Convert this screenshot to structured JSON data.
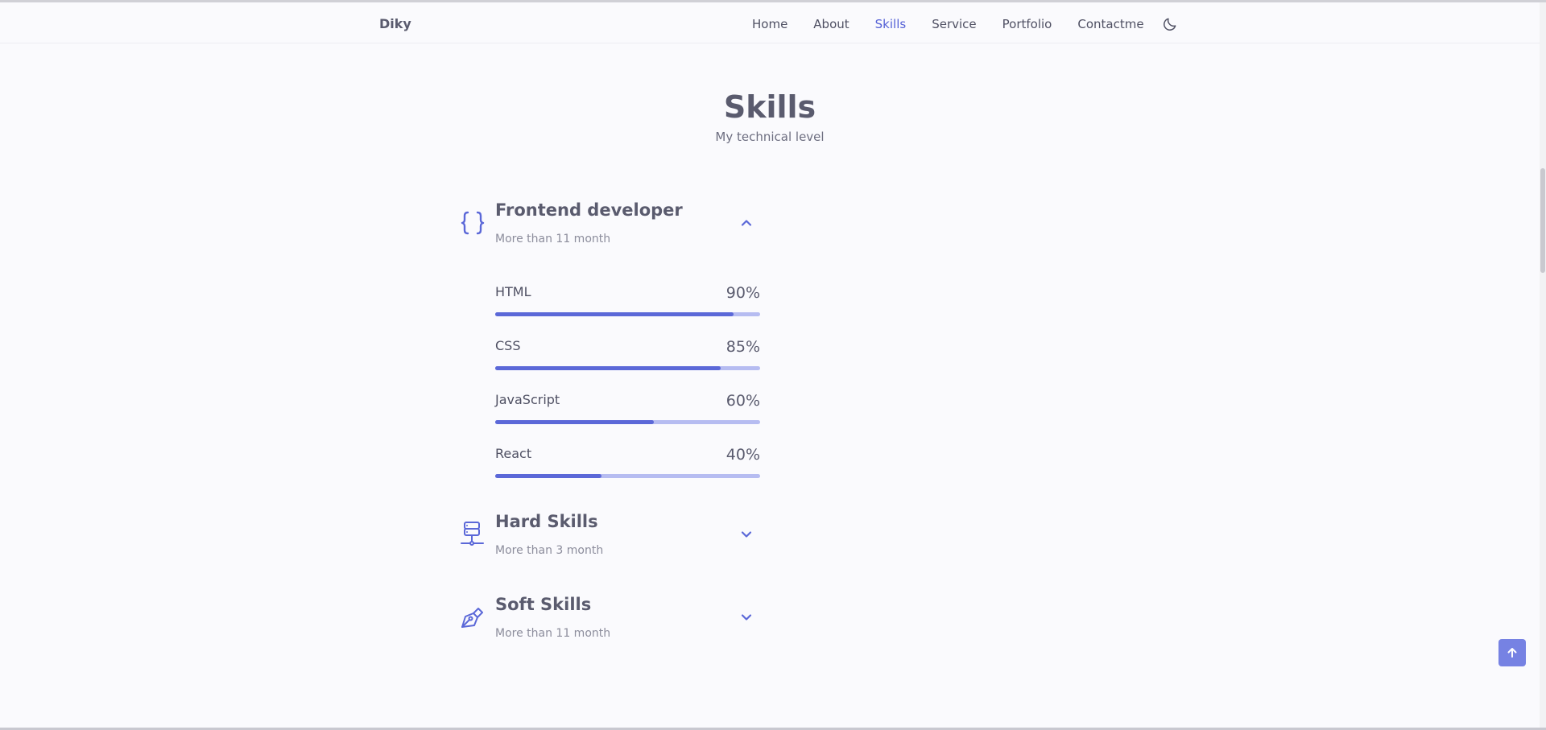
{
  "header": {
    "logo": "Diky",
    "nav": [
      "Home",
      "About",
      "Skills",
      "Service",
      "Portfolio",
      "Contactme"
    ],
    "active_nav": "Skills",
    "theme_icon": "moon-icon"
  },
  "section": {
    "title": "Skills",
    "subtitle": "My technical level"
  },
  "categories": [
    {
      "title": "Frontend developer",
      "subtitle": "More than 11 month",
      "icon": "braces-icon",
      "expanded": true,
      "skills": [
        {
          "name": "HTML",
          "percent_label": "90%",
          "level": 0.9
        },
        {
          "name": "CSS",
          "percent_label": "85%",
          "level": 0.85
        },
        {
          "name": "JavaScript",
          "percent_label": "60%",
          "level": 0.6
        },
        {
          "name": "React",
          "percent_label": "40%",
          "level": 0.4
        }
      ]
    },
    {
      "title": "Hard Skills",
      "subtitle": "More than 3 month",
      "icon": "server-icon",
      "expanded": false
    },
    {
      "title": "Soft Skills",
      "subtitle": "More than 11 month",
      "icon": "pen-nib-icon",
      "expanded": false
    }
  ],
  "colors": {
    "accent": "#5b68d8",
    "accent_light": "#b6bcf1",
    "scroll_up": "#7682e3",
    "text": "#5a5b6e"
  }
}
